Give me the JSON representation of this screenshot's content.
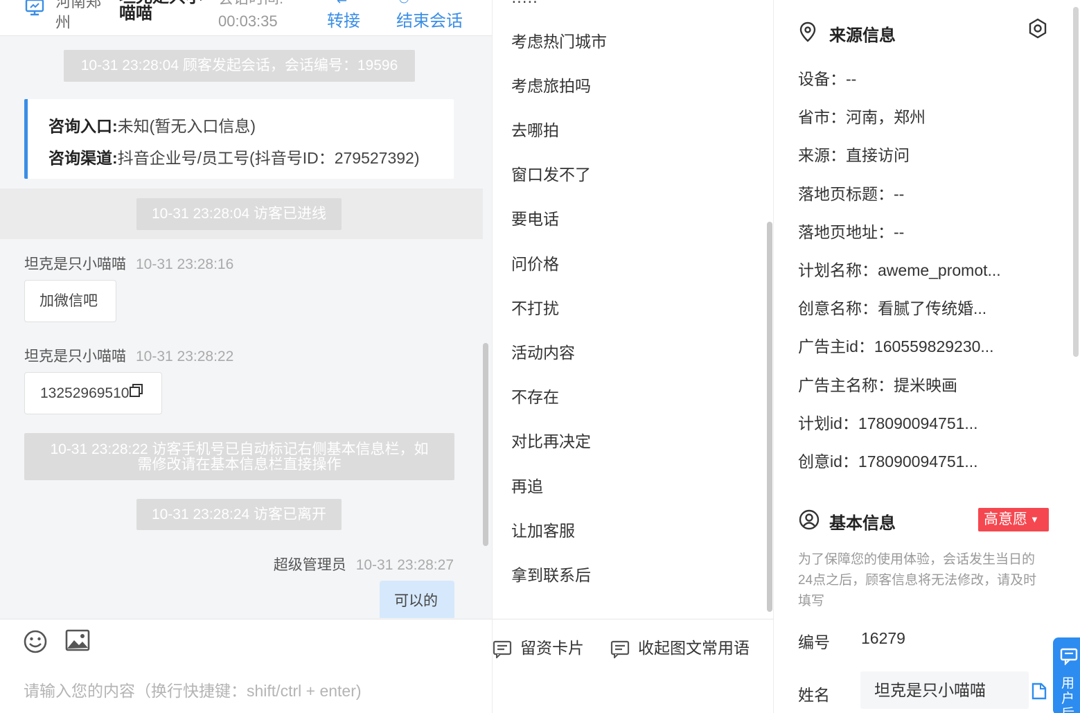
{
  "header": {
    "location": "河南郑州",
    "visitor_name": "坦克是只小喵喵",
    "duration_label": "会话时间:",
    "duration": "00:03:35",
    "transfer_label": "转接",
    "end_label": "结束会话"
  },
  "messages": {
    "sys_start": "10-31 23:28:04 顾客发起会话，会话编号：19596",
    "entry_label": "咨询入口:",
    "entry_value": "未知(暂无入口信息)",
    "channel_label": "咨询渠道:",
    "channel_value": "抖音企业号/员工号(抖音号ID：279527392)",
    "sys_online": "10-31 23:28:04 访客已进线",
    "m1_sender": "坦克是只小喵喵",
    "m1_time": "10-31 23:28:16",
    "m1_text": "加微信吧",
    "m2_sender": "坦克是只小喵喵",
    "m2_time": "10-31 23:28:22",
    "m2_text": "13252969510",
    "sys_phone_line1": "10-31 23:28:22 访客手机号已自动标记右侧基本信息栏，如",
    "sys_phone_line2": "需修改请在基本信息栏直接操作",
    "sys_left": "10-31 23:28:24 访客已离开",
    "m3_sender": "超级管理员",
    "m3_time": "10-31 23:28:27",
    "m3_text": "可以的"
  },
  "composer": {
    "placeholder": "请输入您的内容（换行快捷键：shift/ctrl + enter)",
    "emoji_icon": "smile-icon",
    "image_icon": "image-icon"
  },
  "phrases": {
    "items": [
      "考虑热门城市",
      "考虑旅拍吗",
      "去哪拍",
      "窗口发不了",
      "要电话",
      "问价格",
      "不打扰",
      "活动内容",
      "不存在",
      "对比再决定",
      "再追",
      "让加客服",
      "拿到联系后"
    ],
    "card_label": "留资卡片",
    "collapse_label": "收起图文常用语"
  },
  "source_info": {
    "title": "来源信息",
    "rows": [
      "设备：--",
      "省市：河南，郑州",
      "来源：直接访问",
      "落地页标题：--",
      "落地页地址：--",
      "计划名称：aweme_promot...",
      "创意名称：看腻了传统婚...",
      "广告主id：160559829230...",
      "广告主名称：提米映画",
      "计划id：178090094751...",
      "创意id：178090094751..."
    ]
  },
  "basic_info": {
    "title": "基本信息",
    "intent_badge": "高意愿",
    "notice": "为了保障您的使用体验，会话发生当日的24点之后，顾客信息将无法修改，请及时填写",
    "id_label": "编号",
    "id_value": "16279",
    "name_label": "姓名",
    "name_value": "坦克是只小喵喵",
    "float_label": "用户后"
  },
  "colors": {
    "accent": "#3a8ee6",
    "badge": "#f5474f",
    "float_button": "#2d8cf0",
    "system_message": "#dcdcdc"
  }
}
